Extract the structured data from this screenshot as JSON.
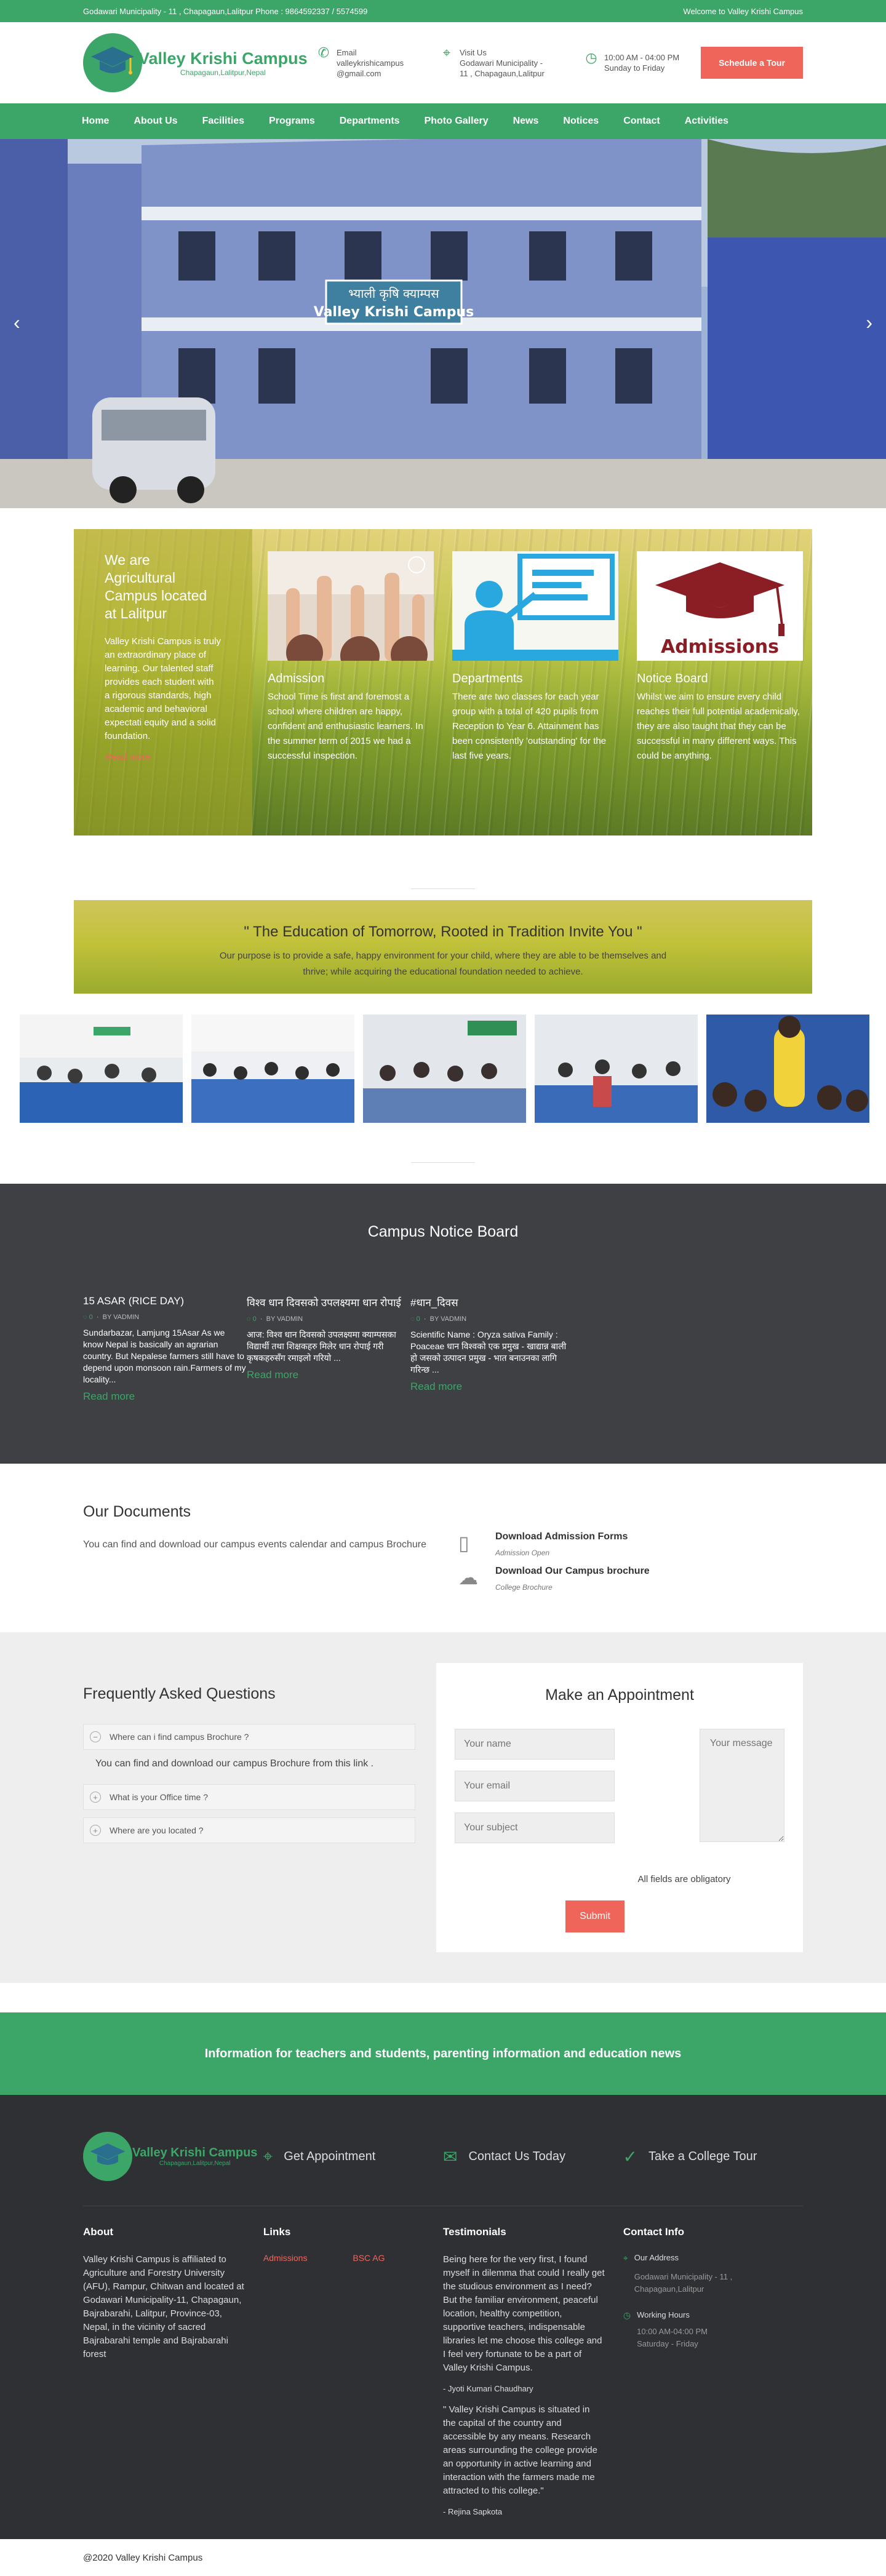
{
  "topbar": {
    "address": "Godawari Municipality - 11 , Chapagaun,Lalitpur Phone : 9864592337 / 5574599",
    "welcome": "Welcome to Valley Krishi Campus"
  },
  "brand": {
    "name": "Valley Krishi Campus",
    "tagline": "Chapagaun,Lalitpur,Nepal"
  },
  "header": {
    "email_label": "Email",
    "email": "valleykrishicampus@gmail.com",
    "visit_label": "Visit Us",
    "visit": "Godawari Municipality - 11 , Chapagaun,Lalitpur",
    "hours": "10:00 AM - 04:00 PM",
    "days": "Sunday to Friday",
    "tour_button": "Schedule a Tour"
  },
  "nav": [
    "Home",
    "About Us",
    "Facilities",
    "Programs",
    "Departments",
    "Photo Gallery",
    "News",
    "Notices",
    "Contact",
    "Activities"
  ],
  "hero": {
    "sign1": "भ्याली कृषि क्याम्पस",
    "sign2": "Valley Krishi Campus",
    "prev": "‹",
    "next": "›"
  },
  "intro": {
    "title": "We are Agricultural Campus located at Lalitpur",
    "text": "Valley Krishi Campus is truly an extraordinary place of learning. Our talented staff provides each student with a rigorous standards, high academic and behavioral expectati equity and a solid foundation.",
    "link": "Read more"
  },
  "cards": [
    {
      "title": "Admission",
      "text": "School Time is first and foremost a school where children are happy, confident and enthusiastic learners. In the summer term of 2015 we had a successful inspection."
    },
    {
      "title": "Departments",
      "text": "There are two classes for each year group with a total of 420 pupils from Reception to Year 6. Attainment has been consistently 'outstanding' for the last five years."
    },
    {
      "title": "Notice Board",
      "text": "Whilst we aim to ensure every child reaches their full potential academically, they are also taught that they can be successful in many different ways. This could be anything.",
      "img_label": "Admissions"
    }
  ],
  "quote": {
    "title": "\" The Education of Tomorrow, Rooted in Tradition Invite You \"",
    "text": "Our purpose is to provide a safe, happy environment for your child, where they are able to be themselves and thrive; while acquiring the educational foundation needed to achieve."
  },
  "notice": {
    "title": "Campus Notice Board",
    "items": [
      {
        "title": "15 ASAR (RICE DAY)",
        "count": "0",
        "by": "BY VADMIN",
        "text": "Sundarbazar, Lamjung 15Asar As we know Nepal is basically an agrarian country. But Nepalese farmers still have to depend upon monsoon rain.Farmers of my locality...",
        "link": "Read more"
      },
      {
        "title": "विश्व धान दिवसको उपलक्ष्यमा धान रोपाई",
        "count": "0",
        "by": "BY VADMIN",
        "text": "आज: विश्व धान दिवसको उपलक्ष्यमा क्याम्पसका विद्यार्थी तथा शिक्षकहरु मिलेर धान रोपाई गरी कृषकहरुसँग रमाइलो गरियो ...",
        "link": "Read more"
      },
      {
        "title": "#धान_दिवस",
        "count": "0",
        "by": "BY VADMIN",
        "text": "Scientific Name : Oryza sativa Family : Poaceae धान विश्वको एक प्रमुख - खाद्यान्न बाली हो जसको उत्पादन प्रमुख - भात बनाउनका लागि गरिन्छ ...",
        "link": "Read more"
      }
    ]
  },
  "docs": {
    "title": "Our Documents",
    "text": "You can find and download our campus events calendar and campus Brochure",
    "items": [
      {
        "title": "Download Admission Forms",
        "sub": "Admission Open"
      },
      {
        "title": "Download Our Campus brochure",
        "sub": "College Brochure"
      }
    ]
  },
  "faq": {
    "title": "Frequently Asked Questions",
    "q1": "Where can i find campus Brochure ?",
    "answer": "You can find and download our campus Brochure from this link .",
    "q2": "What is your Office time ?",
    "q3": "Where are you located ?"
  },
  "appointment": {
    "title": "Make an Appointment",
    "name": "Your name",
    "email": "Your email",
    "subject": "Your subject",
    "message": "Your message",
    "note": "All fields are obligatory",
    "submit": "Submit"
  },
  "banner": "Information for teachers and students, parenting information and education news",
  "footer": {
    "links_top": [
      "Get Appointment",
      "Contact Us Today",
      "Take a College Tour"
    ],
    "about_h": "About",
    "about": "Valley Krishi Campus is affiliated to Agriculture and Forestry University (AFU), Rampur, Chitwan and located at Godawari Municipality-11, Chapagaun, Bajrabarahi, Lalitpur, Province-03, Nepal, in the vicinity of sacred Bajrabarahi temple and Bajrabarahi forest",
    "links_h": "Links",
    "link1": "Admissions",
    "link2": "BSC AG",
    "test_h": "Testimonials",
    "t1": "Being here for the very first, I found myself in dilemma that could I really get the studious environment as I need? But the familiar environment, peaceful location, healthy competition, supportive teachers, indispensable libraries let me choose this college and I feel very fortunate to be a part of Valley Krishi Campus.",
    "t1_by": "- Jyoti Kumari Chaudhary",
    "t2": "\" Valley Krishi Campus is situated in the capital of the country and accessible by any means. Research areas surrounding the college provide an opportunity in active learning and interaction with the farmers made me attracted to this college.\"",
    "t2_by": "- Rejina Sapkota",
    "contact_h": "Contact Info",
    "addr_h": "Our Address",
    "addr": "Godawari Municipality - 11 , Chapagaun,Lalitpur",
    "hours_h": "Working Hours",
    "hours": "10:00 AM-04:00 PM",
    "days": "Saturday - Friday"
  },
  "copyright": "@2020 Valley Krishi Campus",
  "colors": {
    "brand": "#3ba668",
    "accent": "#f0655a",
    "dark": "#3f4043"
  }
}
